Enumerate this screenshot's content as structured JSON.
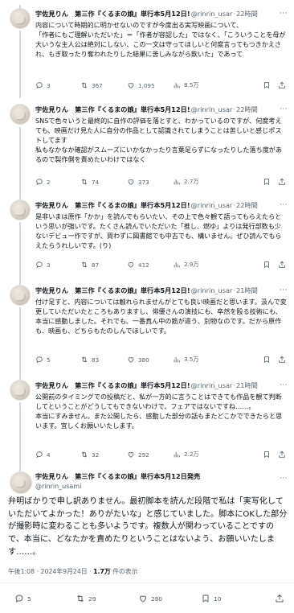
{
  "author": {
    "name": "宇佐見りん　第三作『くるまの娘』単行本5月12日発売",
    "name_short": "宇佐見りん　第三作『くるまの娘』単行本5月12日!",
    "handle": "@rinrin_usar",
    "handle_full": "@rinrin_usami"
  },
  "replies": [
    {
      "time": "22時間",
      "text": "内容について時期的に明かせないのですが今度出る実写映画について、\n「作者にもご理解いただいた」＝「作者が容認した」ではなく、「こういうことを母が大いうな主人公は絶対にしない、この一文は守ってほしいと何度言ってもつきかえされ、もぎ取ったり奪われたりした結果に苦しみながら飲いた」であって",
      "reply": "3",
      "retweet": "367",
      "like": "1,095",
      "views": "8.5万"
    },
    {
      "time": "22時間",
      "text": "SNSで色々いうと最終的に自作の評価を落とすと、わかっているのですが、何度考えても、映画だけ見た人に自分の作品として認識されてしまうことは苦しいと感じポストしてます\n私もなかなか確認がスムーズにいかなかったり言葉足らずになったりした落ち度があるので製作側を責めたいわけではなく",
      "reply": "2",
      "retweet": "74",
      "like": "373",
      "views": "2.7万"
    },
    {
      "time": "22時間",
      "text": "是非いまは原作「かか」を読んでもらいたい、その上で色々観て語ってもらえたらという思いが強いです。たくさん読んでいただいた「推し、燃ゆ」よりは発行部数も少ないデビュー作ですが、買わずに図書館でも中古でも、構いません。ぜひ読んでもらえたらうれしいです。(り)",
      "reply": "3",
      "retweet": "87",
      "like": "412",
      "views": "2.9万"
    },
    {
      "time": "21時間",
      "text": "付け足すと、内容については触れられませんがとても良い映画だと思います。汲んで変更していただいたところもありますし、俳優さんの演技にも、卒然を殴る技術にも、本当に感動しました。それでも、一番真ん中の筋が違う、別物なのです。だから原作も、映画も、どちらもたのしんでほしいです。",
      "reply": "5",
      "retweet": "83",
      "like": "380",
      "views": "3.5万"
    },
    {
      "time": "21時間",
      "text": "公開前のタイミングでの投稿だと、私が一方的に言うことはできても作品を観て判断してということがどうしてもできないわけで、フェアではないですね……。\n本当にすみません。また公開したら、感動した部分の話もまたどこかでできたらと思います。宜しくお願いいたします。",
      "reply": "4",
      "retweet": "32",
      "like": "292",
      "views": "2.2万"
    }
  ],
  "main": {
    "text": "弁明ばかりで申し訳ありません。最初脚本を読んだ段階で私は「実写化していただいてよかった！ありがたいな」と感じていました。脚本にOKした部分が撮影時に変わることも多いようです。複数人が関わっていることですので、本当に、どなたかを責めたりということはないよう、お願いいたします……。",
    "time": "午後1:08 · 2024年9月24日",
    "views_count": "1.7万",
    "views_label": "件の表示",
    "reply": "5",
    "retweet": "29",
    "like": "280",
    "bookmark": "10"
  },
  "icons": [
    "reply-icon",
    "retweet-icon",
    "like-icon",
    "views-icon",
    "bookmark-icon",
    "share-icon",
    "more-icon"
  ]
}
